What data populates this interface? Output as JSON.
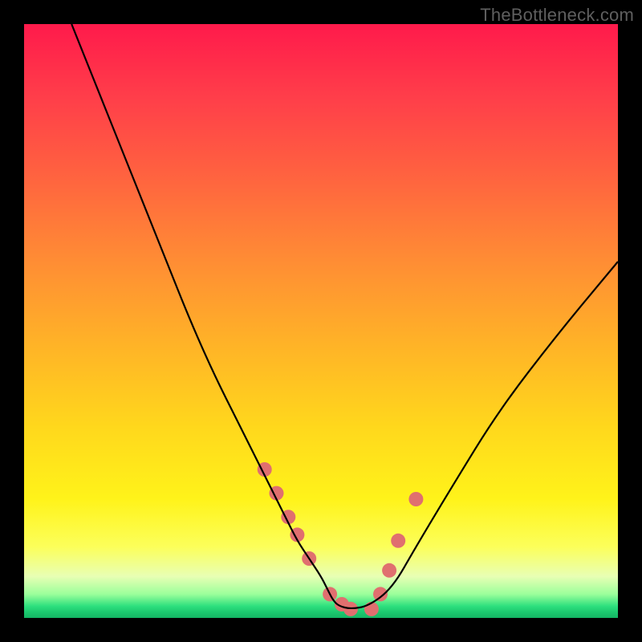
{
  "watermark": "TheBottleneck.com",
  "chart_data": {
    "type": "line",
    "title": "",
    "xlabel": "",
    "ylabel": "",
    "xlim": [
      0,
      100
    ],
    "ylim": [
      0,
      100
    ],
    "grid": false,
    "legend": false,
    "series": [
      {
        "name": "curve",
        "x": [
          8,
          12,
          16,
          20,
          24,
          28,
          32,
          36,
          40,
          42,
          44,
          46,
          48,
          50,
          51,
          52,
          53,
          55,
          58,
          62,
          66,
          72,
          80,
          90,
          100
        ],
        "y": [
          100,
          90,
          80,
          70,
          60,
          50,
          41,
          33,
          25,
          21,
          17,
          13,
          10,
          7,
          5,
          3,
          2,
          1.5,
          2,
          5,
          12,
          22,
          35,
          48,
          60
        ],
        "color": "#000000"
      }
    ],
    "markers": {
      "name": "highlight-dots",
      "color": "#e06f6f",
      "radius": 9,
      "x": [
        40.5,
        42.5,
        44.5,
        46.0,
        48.0,
        51.5,
        53.5,
        55.0,
        58.5,
        60.0,
        61.5,
        63.0,
        66.0
      ],
      "y": [
        25,
        21,
        17,
        14,
        10,
        4,
        2.3,
        1.5,
        1.5,
        4,
        8,
        13,
        20
      ]
    },
    "background_gradient": {
      "stops": [
        {
          "pos": 0.0,
          "color": "#ff1a4b"
        },
        {
          "pos": 0.12,
          "color": "#ff3d4a"
        },
        {
          "pos": 0.26,
          "color": "#ff643f"
        },
        {
          "pos": 0.4,
          "color": "#ff8d34"
        },
        {
          "pos": 0.54,
          "color": "#ffb327"
        },
        {
          "pos": 0.68,
          "color": "#ffd81c"
        },
        {
          "pos": 0.8,
          "color": "#fff31a"
        },
        {
          "pos": 0.88,
          "color": "#fcff5a"
        },
        {
          "pos": 0.93,
          "color": "#e8ffb4"
        },
        {
          "pos": 0.96,
          "color": "#9bff9b"
        },
        {
          "pos": 0.98,
          "color": "#2ee07e"
        },
        {
          "pos": 0.99,
          "color": "#1cc96f"
        },
        {
          "pos": 1.0,
          "color": "#14b564"
        }
      ]
    }
  }
}
